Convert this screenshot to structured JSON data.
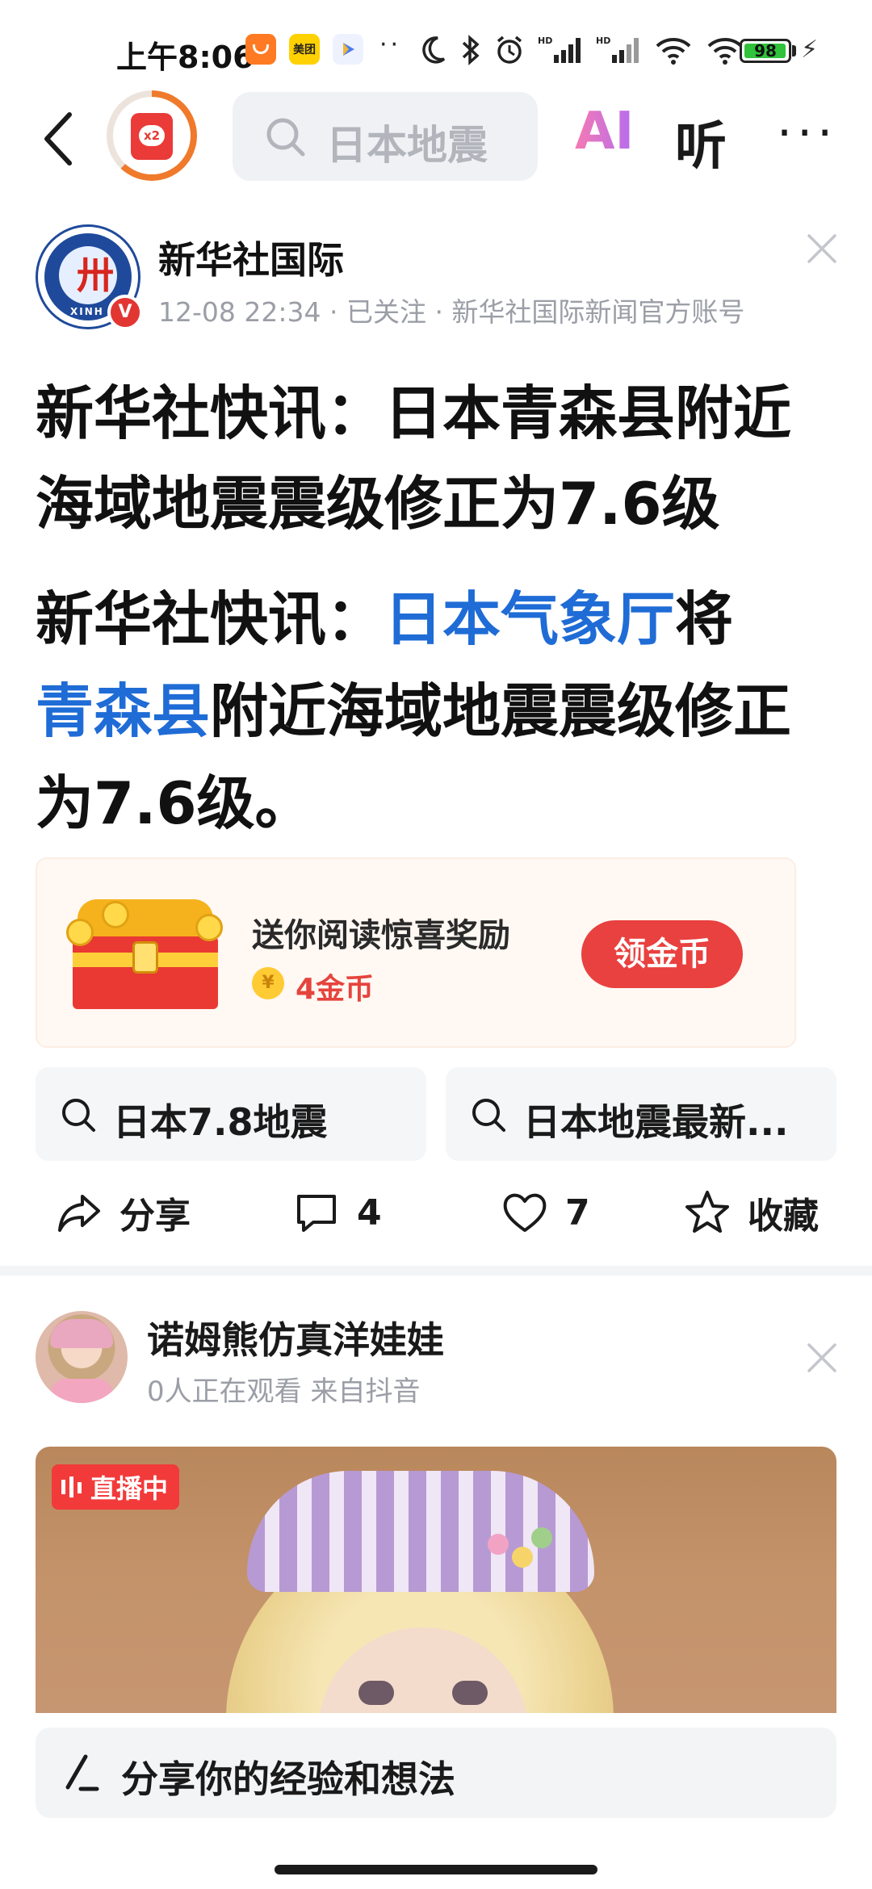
{
  "status_bar": {
    "time": "上午8:06",
    "app_icons": [
      {
        "name": "taobao-icon",
        "label": "",
        "color": "#ff7a22"
      },
      {
        "name": "meituan-icon",
        "label": "美团",
        "color": "#ffd100"
      },
      {
        "name": "video-app-icon",
        "label": "",
        "color": "#4a7cf0"
      }
    ],
    "more_dots": "··",
    "battery": "98",
    "battery_fraction": 0.98
  },
  "nav": {
    "back_icon": "chevron-left-icon",
    "red_packet_badge": "x2",
    "search_placeholder": "日本地震",
    "ai_label": "AI",
    "listen_label": "听",
    "more_label": "···"
  },
  "author": {
    "logo_text": "XINH",
    "verified_badge": "V",
    "name": "新华社国际",
    "meta": "12-08 22:34 · 已关注 · 新华社国际新闻官方账号"
  },
  "article": {
    "headline": "新华社快讯：日本青森县附近海域地震震级修正为7.6级",
    "body_prefix": "新华社快讯：",
    "body_link1": "日本气象厅",
    "body_mid": "将",
    "body_link2": "青森县",
    "body_suffix": "附近海域地震震级修正为7.6级。"
  },
  "reward": {
    "title": "送你阅读惊喜奖励",
    "coin_symbol": "¥",
    "coins": "4金币",
    "button": "领金币"
  },
  "related_searches": [
    "日本7.8地震",
    "日本地震最新..."
  ],
  "actions": {
    "share": "分享",
    "comments": "4",
    "likes": "7",
    "favorite": "收藏"
  },
  "second_card": {
    "name": "诺姆熊仿真洋娃娃",
    "meta": "0人正在观看  来自抖音",
    "live_badge": "直播中"
  },
  "comment_box": {
    "placeholder": "分享你的经验和想法"
  },
  "colors": {
    "link_blue": "#1f6cd6",
    "accent_red": "#e8413f",
    "coin_red": "#e5443d"
  }
}
